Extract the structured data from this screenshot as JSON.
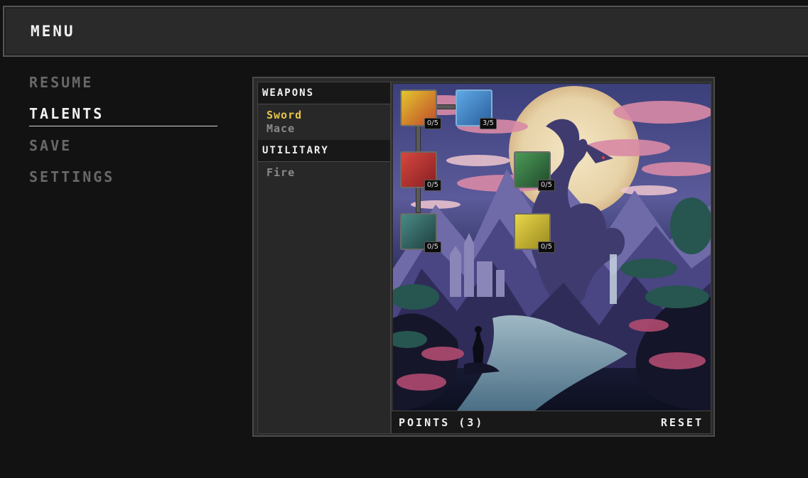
{
  "header": {
    "title": "MENU"
  },
  "nav": [
    {
      "label": "RESUME",
      "active": false
    },
    {
      "label": "TALENTS",
      "active": true
    },
    {
      "label": "SAVE",
      "active": false
    },
    {
      "label": "SETTINGS",
      "active": false
    }
  ],
  "categories": {
    "weapons": {
      "title": "WEAPONS",
      "items": [
        "Sword",
        "Mace"
      ],
      "selected": "Sword"
    },
    "utilitary": {
      "title": "UTILITARY",
      "items": [
        "Fire"
      ]
    }
  },
  "talents": [
    {
      "icon": "knight-icon",
      "rank": "0/5"
    },
    {
      "icon": "sword-slash-icon",
      "rank": "3/5"
    },
    {
      "icon": "sword-strike-icon",
      "rank": "0/5"
    },
    {
      "icon": "crossed-blades-icon",
      "rank": "0/5"
    },
    {
      "icon": "shield-icon",
      "rank": "0/5"
    },
    {
      "icon": "helmet-icon",
      "rank": "0/5"
    }
  ],
  "footer": {
    "points_label": "POINTS (3)",
    "reset_label": "RESET"
  },
  "colors": {
    "selected": "#e8c547",
    "inactive_nav": "#686868",
    "background": "#121212"
  }
}
